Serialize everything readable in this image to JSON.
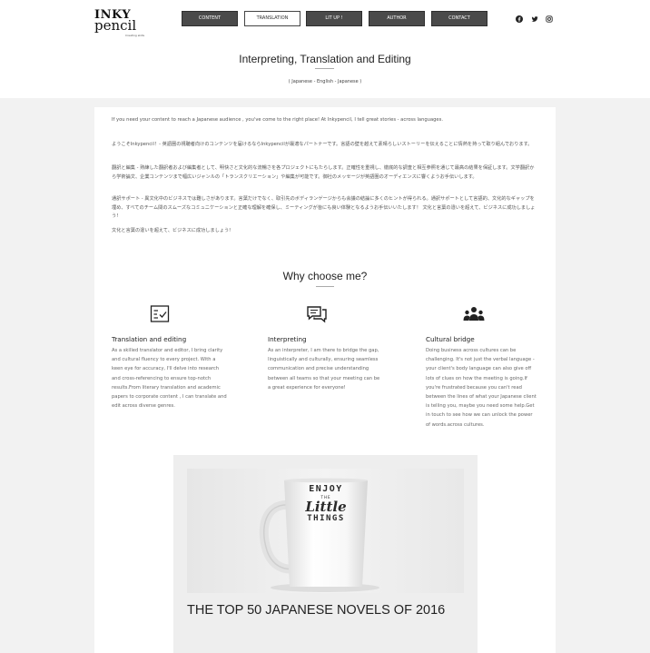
{
  "logo": {
    "line1": "INKY",
    "line2": "pencil",
    "tagline": "Creating skills"
  },
  "nav": {
    "items": [
      {
        "label": "CONTENT",
        "active": false
      },
      {
        "label": "TRANSLATION",
        "active": true
      },
      {
        "label": "LIT UP !",
        "active": false
      },
      {
        "label": "AUTHOR",
        "active": false
      },
      {
        "label": "CONTACT",
        "active": false
      }
    ]
  },
  "social": [
    "facebook-icon",
    "twitter-icon",
    "instagram-icon"
  ],
  "page": {
    "title": "Interpreting, Translation and Editing",
    "subtitle": "( Japanese - English - Japanese )"
  },
  "intro": {
    "paragraphs": [
      "If you need your content to reach a Japanese audience , you've come to the right place! At Inkypencil, I tell great stories - across languages.",
      "ようこそInkypencil！- 英語圏の視聴者向けのコンテンツを届けるならInkypencilが最適なパートナーです。言語の壁を越えて素晴らしいストーリーを伝えることに情熱を持って取り組んでおります。",
      "翻訳と編集 - 熟練した翻訳者および編集者として、明快さと文化的な流暢さを各プロジェクトにもたらします。正確性を重視し、徹底的な調査と相互参照を通じて最高の結果を保証します。文学翻訳から学術論文、企業コンテンツまで幅広いジャンルの「トランスクリエーション」や編集が可能です。御社のメッセージが英語圏のオーディエンスに響くようお手伝いします。",
      "通訳サポート - 異文化中のビジネスでは難しさがあります。言葉だけでなく、取引先のボディランゲージからも会議の結論に多くのヒントが得られる。通訳サポートとして言語的、文化的なギャップを埋め、すべてのチーム間のスムーズなコミュニケーションと正確な理解を確保し、ミーティングが皆にも良い体験となるようお手伝いいたします！ 文化と言葉の違いを超えて、ビジネスに成功しましょう!",
      "文化と言葉の違いを超えて、ビジネスに成功しましょう!"
    ]
  },
  "why": {
    "title": "Why choose me?",
    "features": [
      {
        "icon": "checklist-icon",
        "title": "Translation and editing",
        "desc": "As a skilled translator and editor, I bring clarity and cultural fluency to every project. With a keen eye for accuracy, I'll delve into research and cross-referencing to ensure top-notch results.From literary translation and academic papers to corporate content , I can translate and edit across diverse genres."
      },
      {
        "icon": "chat-bubbles-icon",
        "title": "Interpreting",
        "desc": "As an interpreter, I am there to bridge the gap, linguistically and culturally, ensuring seamless communication and precise understanding between all teams so that your meeting can be a great experience for everyone!"
      },
      {
        "icon": "group-icon",
        "title": "Cultural bridge",
        "desc": "Doing business across cultures can be challenging. It's not just the verbal language - your client's body language can also give off lots of clues on how the meeting is going.If you're frustrated because you can't read between the lines of what your Japanese client is telling you, maybe you need some help.Get in touch to see how we can unlock the power of words.across cultures."
      }
    ]
  },
  "blog": {
    "mug_text": {
      "line1": "ENJOY",
      "line2": "THE",
      "line3": "Little",
      "line4": "THINGS"
    },
    "title": "THE TOP 50 JAPANESE NOVELS OF 2016"
  }
}
